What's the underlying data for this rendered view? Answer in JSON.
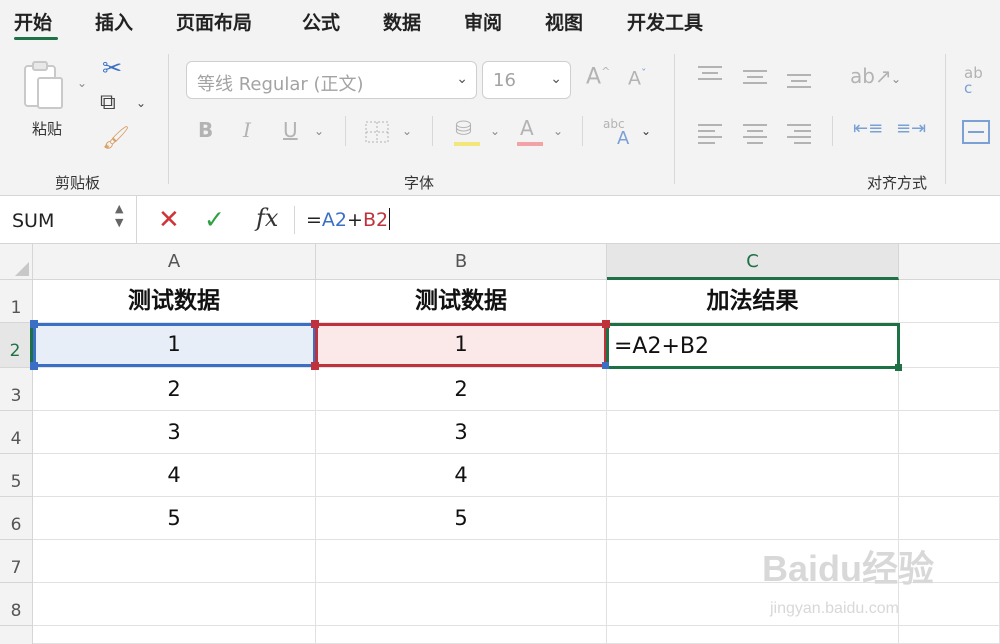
{
  "menu": {
    "tabs": [
      "开始",
      "插入",
      "页面布局",
      "公式",
      "数据",
      "审阅",
      "视图",
      "开发工具"
    ],
    "active_tab": "开始"
  },
  "ribbon": {
    "clipboard": {
      "paste_label": "粘贴",
      "group_label": "剪贴板"
    },
    "font": {
      "font_name": "等线 Regular (正文)",
      "font_size": "16",
      "group_label": "字体",
      "bold": "B",
      "italic": "I",
      "underline": "U",
      "font_color_glyph": "A",
      "increase_size_glyph": "A",
      "decrease_size_glyph": "A",
      "abc_glyph": "abc"
    },
    "alignment": {
      "group_label": "对齐方式"
    },
    "abc_partial": "ab"
  },
  "formula_bar": {
    "name_box": "SUM",
    "fx": "fx",
    "formula_prefix": "=",
    "ref_a": "A2",
    "operator": "+",
    "ref_b": "B2"
  },
  "sheet": {
    "columns": [
      "A",
      "B",
      "C"
    ],
    "rows": [
      "1",
      "2",
      "3",
      "4",
      "5",
      "6",
      "7",
      "8"
    ],
    "headers": [
      "测试数据",
      "测试数据",
      "加法结果"
    ],
    "col_a_values": [
      "1",
      "2",
      "3",
      "4",
      "5"
    ],
    "col_b_values": [
      "1",
      "2",
      "3",
      "4",
      "5"
    ],
    "editing_cell": "C2",
    "editing_text": "=A2+B2"
  },
  "colors": {
    "accent_green": "#1e7145",
    "ref_blue": "#3b6fc5",
    "ref_red": "#c0323b",
    "cancel_red": "#d13438",
    "confirm_green": "#2ea043"
  },
  "watermark": {
    "main": "Baidu经验",
    "sub": "jingyan.baidu.com"
  }
}
